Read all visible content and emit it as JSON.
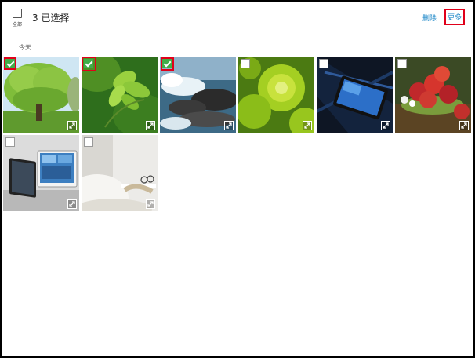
{
  "header": {
    "select_all_label": "全部",
    "selection_count": "3 已选择",
    "delete_label": "删除",
    "more_label": "更多"
  },
  "section": {
    "title": "今天"
  },
  "photos": [
    {
      "subject": "tree",
      "selected": true
    },
    {
      "subject": "green-leaves",
      "selected": true
    },
    {
      "subject": "ocean-rocks",
      "selected": true
    },
    {
      "subject": "green-succulent",
      "selected": false
    },
    {
      "subject": "tablet-dark",
      "selected": false
    },
    {
      "subject": "red-apples",
      "selected": false
    },
    {
      "subject": "tablet-stand",
      "selected": false
    },
    {
      "subject": "white-sofa",
      "selected": false
    }
  ],
  "colors": {
    "accent": "#1e88c8",
    "highlight": "#e0001a",
    "check_green": "#3fae49"
  },
  "icons": [
    "select-all-checkbox-icon",
    "checkbox-icon",
    "checkmark-icon",
    "expand-icon"
  ]
}
